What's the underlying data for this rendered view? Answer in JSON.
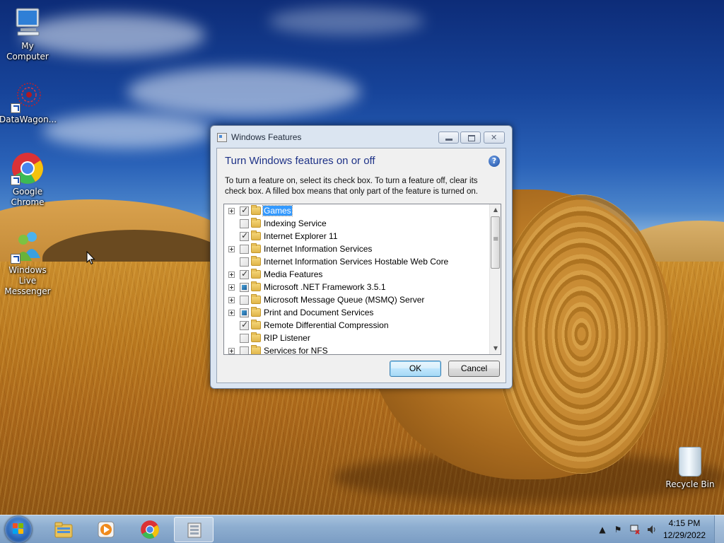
{
  "desktop": {
    "icons": [
      {
        "label": "My Computer",
        "icon": "computer-icon"
      },
      {
        "label": "DataWagon...",
        "icon": "datawagon-icon"
      },
      {
        "label": "Google Chrome",
        "icon": "chrome-icon"
      },
      {
        "label": "Windows Live Messenger",
        "icon": "messenger-icon"
      }
    ],
    "recycle_bin": {
      "label": "Recycle Bin",
      "icon": "recycle-bin-icon"
    }
  },
  "window": {
    "title": "Windows Features",
    "heading": "Turn Windows features on or off",
    "help_icon": "?",
    "description": "To turn a feature on, select its check box. To turn a feature off, clear its check box. A filled box means that only part of the feature is turned on.",
    "features": [
      {
        "label": "Games",
        "state": "checked",
        "expandable": true,
        "selected": true
      },
      {
        "label": "Indexing Service",
        "state": "unchecked",
        "expandable": false,
        "selected": false
      },
      {
        "label": "Internet Explorer 11",
        "state": "checked",
        "expandable": false,
        "selected": false
      },
      {
        "label": "Internet Information Services",
        "state": "unchecked",
        "expandable": true,
        "selected": false
      },
      {
        "label": "Internet Information Services Hostable Web Core",
        "state": "unchecked",
        "expandable": false,
        "selected": false
      },
      {
        "label": "Media Features",
        "state": "checked",
        "expandable": true,
        "selected": false
      },
      {
        "label": "Microsoft .NET Framework 3.5.1",
        "state": "partial",
        "expandable": true,
        "selected": false
      },
      {
        "label": "Microsoft Message Queue (MSMQ) Server",
        "state": "unchecked",
        "expandable": true,
        "selected": false
      },
      {
        "label": "Print and Document Services",
        "state": "partial",
        "expandable": true,
        "selected": false
      },
      {
        "label": "Remote Differential Compression",
        "state": "checked",
        "expandable": false,
        "selected": false
      },
      {
        "label": "RIP Listener",
        "state": "unchecked",
        "expandable": false,
        "selected": false
      },
      {
        "label": "Services for NFS",
        "state": "unchecked",
        "expandable": true,
        "selected": false
      }
    ],
    "ok_label": "OK",
    "cancel_label": "Cancel"
  },
  "taskbar": {
    "pinned": [
      {
        "name": "windows-explorer-icon"
      },
      {
        "name": "media-player-icon"
      },
      {
        "name": "chrome-icon"
      },
      {
        "name": "windows-features-icon",
        "active": true
      }
    ],
    "clock": {
      "time": "4:15 PM",
      "date": "12/29/2022"
    }
  },
  "colors": {
    "heading": "#1e3287",
    "selection": "#3399ff",
    "taskbar": "#8eaed0"
  }
}
